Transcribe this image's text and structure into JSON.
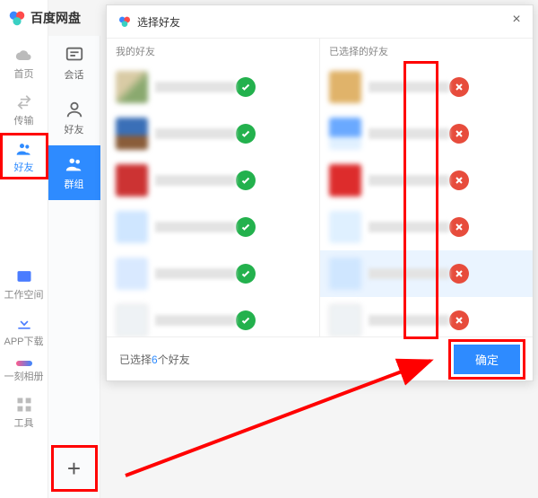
{
  "app": {
    "name": "百度网盘"
  },
  "leftnav": {
    "home": "首页",
    "transfer": "传输",
    "friends": "好友",
    "workspace": "工作空间",
    "appdl": "APP下载",
    "album": "一刻相册",
    "tools": "工具"
  },
  "subnav": {
    "chat": "会话",
    "friends": "好友",
    "groups": "群组",
    "plus": "+"
  },
  "dialog": {
    "title": "选择好友",
    "left_header": "我的好友",
    "right_header": "已选择的好友",
    "footer_prefix": "已选择",
    "footer_count": "6",
    "footer_suffix": "个好友",
    "ok": "确定",
    "close": "×"
  },
  "left_friends": [
    {
      "id": "f1",
      "selected": true
    },
    {
      "id": "f2",
      "selected": true
    },
    {
      "id": "f3",
      "selected": true
    },
    {
      "id": "f4",
      "selected": true
    },
    {
      "id": "f5",
      "selected": true
    },
    {
      "id": "f6",
      "selected": true
    }
  ],
  "right_friends": [
    {
      "id": "f1"
    },
    {
      "id": "f2"
    },
    {
      "id": "f3"
    },
    {
      "id": "f4"
    },
    {
      "id": "f5"
    },
    {
      "id": "f6"
    }
  ],
  "colors": {
    "primary": "#2e8bff",
    "ok": "#23b14d",
    "rm": "#e74c3c",
    "highlight": "#ff0000"
  }
}
